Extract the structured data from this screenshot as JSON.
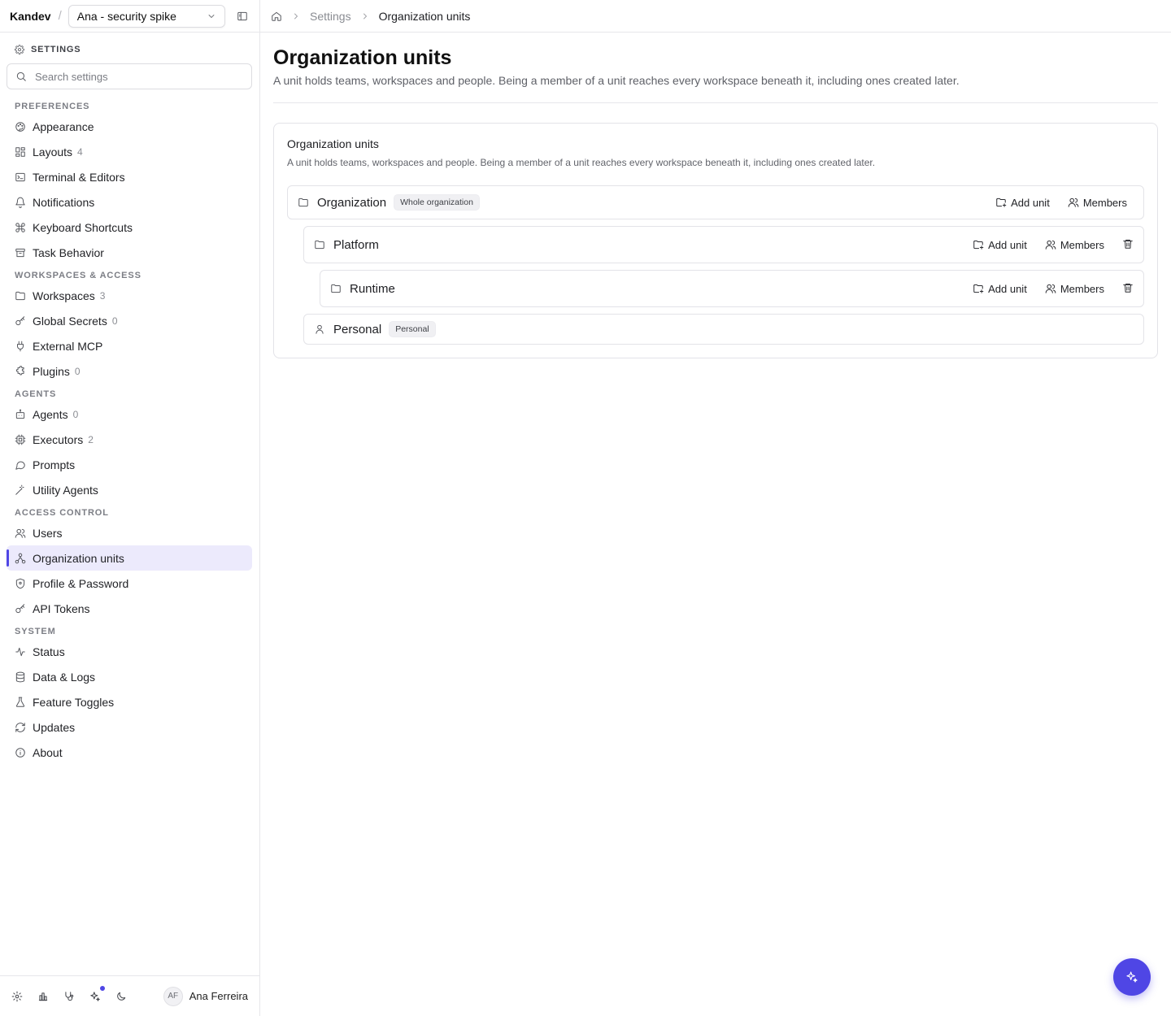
{
  "app": {
    "brand": "Kandev",
    "workspace": "Ana - security spike"
  },
  "sidebar": {
    "section_title": "SETTINGS",
    "search_placeholder": "Search settings",
    "groups": [
      {
        "label": "PREFERENCES",
        "items": [
          {
            "label": "Appearance",
            "icon": "palette-icon"
          },
          {
            "label": "Layouts",
            "count": "4",
            "icon": "layout-icon"
          },
          {
            "label": "Terminal & Editors",
            "icon": "terminal-icon"
          },
          {
            "label": "Notifications",
            "icon": "bell-icon"
          },
          {
            "label": "Keyboard Shortcuts",
            "icon": "command-icon"
          },
          {
            "label": "Task Behavior",
            "icon": "archive-icon"
          }
        ]
      },
      {
        "label": "WORKSPACES & ACCESS",
        "items": [
          {
            "label": "Workspaces",
            "count": "3",
            "icon": "folder-icon"
          },
          {
            "label": "Global Secrets",
            "count": "0",
            "icon": "key-icon"
          },
          {
            "label": "External MCP",
            "icon": "plug-icon"
          },
          {
            "label": "Plugins",
            "count": "0",
            "icon": "puzzle-icon"
          }
        ]
      },
      {
        "label": "AGENTS",
        "items": [
          {
            "label": "Agents",
            "count": "0",
            "icon": "bot-icon"
          },
          {
            "label": "Executors",
            "count": "2",
            "icon": "cpu-icon"
          },
          {
            "label": "Prompts",
            "icon": "message-icon"
          },
          {
            "label": "Utility Agents",
            "icon": "wand-icon"
          }
        ]
      },
      {
        "label": "ACCESS CONTROL",
        "items": [
          {
            "label": "Users",
            "icon": "users-icon"
          },
          {
            "label": "Organization units",
            "icon": "network-icon",
            "active": true
          },
          {
            "label": "Profile & Password",
            "icon": "shield-icon"
          },
          {
            "label": "API Tokens",
            "icon": "key-icon"
          }
        ]
      },
      {
        "label": "SYSTEM",
        "items": [
          {
            "label": "Status",
            "icon": "activity-icon"
          },
          {
            "label": "Data & Logs",
            "icon": "database-icon"
          },
          {
            "label": "Feature Toggles",
            "icon": "flask-icon"
          },
          {
            "label": "Updates",
            "icon": "refresh-icon"
          },
          {
            "label": "About",
            "icon": "info-icon"
          }
        ]
      }
    ],
    "user": {
      "initials": "AF",
      "name": "Ana Ferreira"
    }
  },
  "breadcrumb": {
    "settings": "Settings",
    "current": "Organization units"
  },
  "page": {
    "title": "Organization units",
    "description": "A unit holds teams, workspaces and people. Being a member of a unit reaches every workspace beneath it, including ones created later."
  },
  "card": {
    "title": "Organization units",
    "description": "A unit holds teams, workspaces and people. Being a member of a unit reaches every workspace beneath it, including ones created later.",
    "add_unit_label": "Add unit",
    "members_label": "Members",
    "units": [
      {
        "name": "Organization",
        "badge": "Whole organization"
      },
      {
        "name": "Platform"
      },
      {
        "name": "Runtime"
      },
      {
        "name": "Personal",
        "badge": "Personal"
      }
    ]
  },
  "colors": {
    "accent": "#4f46e5",
    "active_bg": "#eceafc"
  }
}
